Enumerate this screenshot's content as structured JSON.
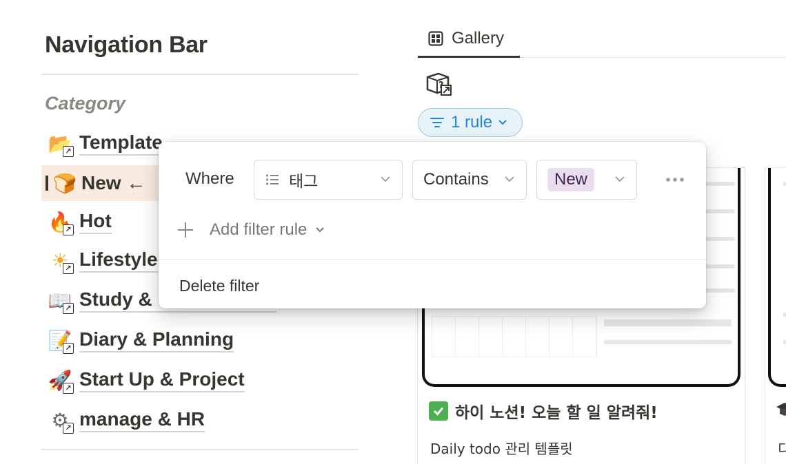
{
  "nav": {
    "title": "Navigation Bar",
    "category_heading": "Category",
    "items": [
      {
        "label": "Template",
        "icon": "folder-icon",
        "glyph": "📂"
      },
      {
        "label": "New ←",
        "icon": "bread-icon",
        "glyph": "🍞",
        "active": true
      },
      {
        "label": "Hot",
        "icon": "fire-icon",
        "glyph": "🔥"
      },
      {
        "label": "Lifestyle",
        "icon": "sun-icon",
        "glyph": "☀"
      },
      {
        "label": "Study &",
        "icon": "book-icon",
        "glyph": "📖"
      },
      {
        "label": "Diary & Planning",
        "icon": "memo-icon",
        "glyph": "📝"
      },
      {
        "label": "Start Up & Project",
        "icon": "rocket-icon",
        "glyph": "🚀"
      },
      {
        "label": "manage & HR",
        "icon": "gear-icon",
        "glyph": "⚙"
      }
    ]
  },
  "view": {
    "tab_label": "Gallery",
    "tab_icon": "gallery-grid-icon",
    "filter_pill": "1 rule"
  },
  "filter": {
    "where_label": "Where",
    "property": "태그",
    "operator": "Contains",
    "value": "New",
    "add_rule": "Add filter rule",
    "delete": "Delete filter"
  },
  "cards": [
    {
      "title": "하이 노션! 오늘 할 일 알려줘!",
      "description": "Daily todo 관리 템플릿",
      "icon": "check-mark-icon"
    },
    {
      "title": "",
      "description": "디",
      "icon": "graduation-cap-icon"
    }
  ],
  "colors": {
    "accent": "#2383e2",
    "pill_bg": "#e7f3f8",
    "active_nav_bg": "#f9ebe0",
    "tag_new_bg": "#e8deee",
    "tag_new_text": "#412454"
  }
}
